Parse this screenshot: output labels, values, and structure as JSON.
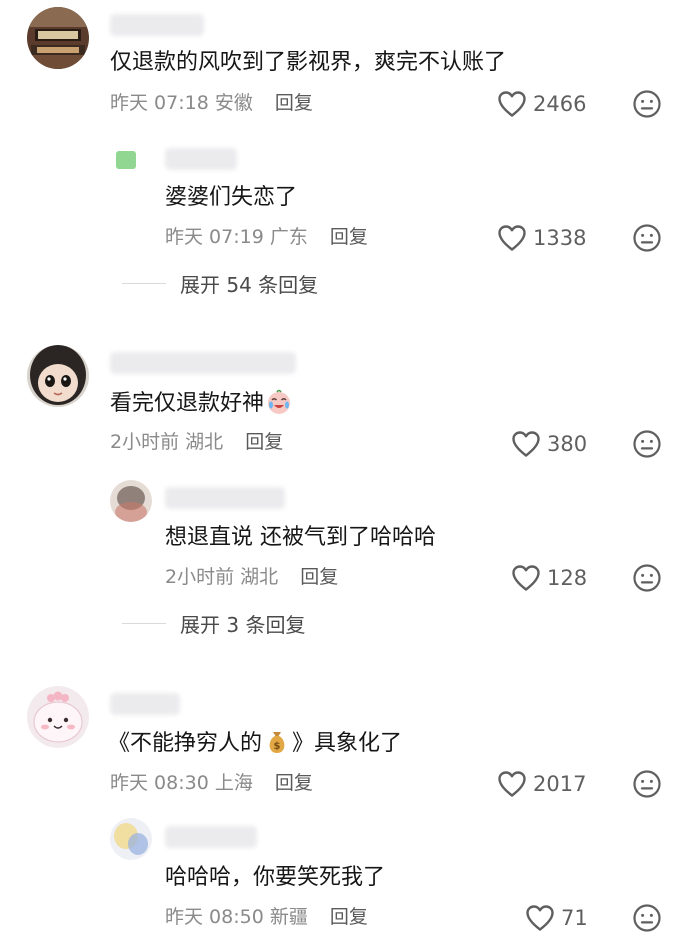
{
  "comments": [
    {
      "text": "仅退款的风吹到了影视界，爽完不认账了",
      "time": "昨天 07:18",
      "location": "安徽",
      "reply_label": "回复",
      "likes": "2466",
      "replies": [
        {
          "text": "婆婆们失恋了",
          "time": "昨天 07:19",
          "location": "广东",
          "reply_label": "回复",
          "likes": "1338"
        }
      ],
      "expand_label": "展开 54 条回复"
    },
    {
      "text": "看完仅退款好神",
      "time": "2小时前",
      "location": "湖北",
      "reply_label": "回复",
      "likes": "380",
      "replies": [
        {
          "text": "想退直说 还被气到了哈哈哈",
          "time": "2小时前",
          "location": "湖北",
          "reply_label": "回复",
          "likes": "128"
        }
      ],
      "expand_label": "展开 3 条回复"
    },
    {
      "text_before": "《不能挣穷人的",
      "text_after": "》具象化了",
      "emoji": "money-bag-icon",
      "time": "昨天 08:30",
      "location": "上海",
      "reply_label": "回复",
      "likes": "2017",
      "replies": [
        {
          "text": "哈哈哈，你要笑死我了",
          "time": "昨天 08:50",
          "location": "新疆",
          "reply_label": "回复",
          "likes": "71"
        }
      ]
    }
  ],
  "icons": {
    "like": "heart-outline-icon",
    "dislike": "neutral-face-icon"
  },
  "colors": {
    "text": "#161616",
    "meta": "#8a8a8a",
    "icon": "#5f5f5f"
  }
}
